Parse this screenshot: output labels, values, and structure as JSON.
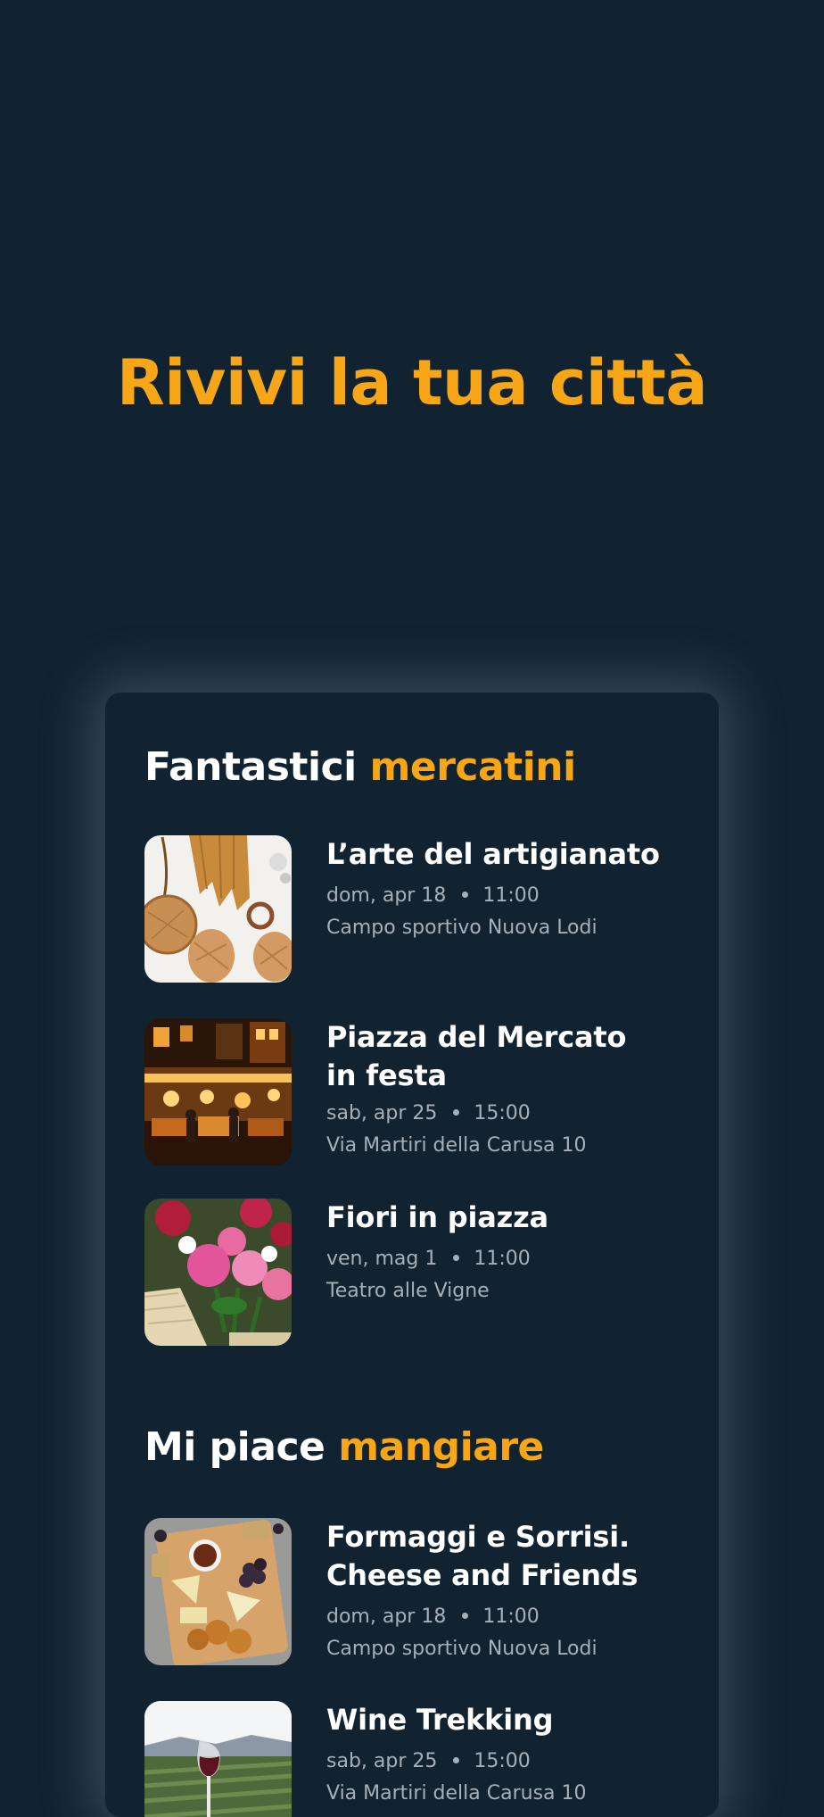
{
  "hero": {
    "title": "Rivivi la tua città"
  },
  "sections": [
    {
      "title_main": "Fantastici",
      "title_accent": "mercatini",
      "events": [
        {
          "title": "L’arte del artigianato",
          "date": "dom, apr 18",
          "time": "11:00",
          "location": "Campo sportivo Nuova Lodi",
          "image": "crafts-photo"
        },
        {
          "title": "Piazza del Mercato in festa",
          "date": "sab, apr 25",
          "time": "15:00",
          "location": "Via Martiri della Carusa 10",
          "image": "night-market-photo"
        },
        {
          "title": "Fiori in piazza",
          "date": "ven, mag 1",
          "time": "11:00",
          "location": "Teatro alle Vigne",
          "image": "flowers-photo"
        }
      ]
    },
    {
      "title_main": "Mi piace",
      "title_accent": "mangiare",
      "events": [
        {
          "title": "Formaggi e Sorrisi. Cheese and Friends",
          "date": "dom, apr 18",
          "time": "11:00",
          "location": "Campo sportivo Nuova Lodi",
          "image": "cheese-board-photo"
        },
        {
          "title": "Wine Trekking",
          "date": "sab, apr 25",
          "time": "15:00",
          "location": "Via Martiri della Carusa 10",
          "image": "vineyard-photo"
        }
      ]
    }
  ],
  "colors": {
    "background": "#112330",
    "accent": "#f6a616",
    "text": "#ffffff",
    "muted": "#a7b0b8"
  }
}
